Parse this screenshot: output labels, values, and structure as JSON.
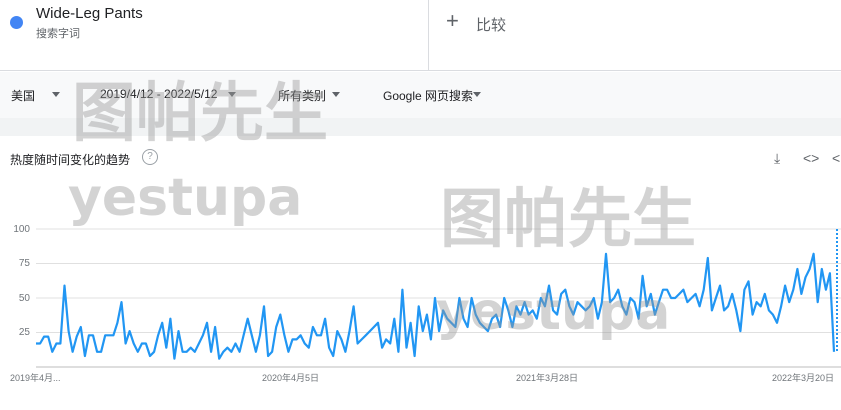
{
  "term": {
    "name": "Wide-Leg Pants",
    "type": "搜索字词"
  },
  "compare": {
    "plus": "+",
    "label": "比较"
  },
  "filters": {
    "region": "美国",
    "date_range": "2019/4/12 - 2022/5/12",
    "category": "所有类别",
    "search_type": "Google 网页搜索"
  },
  "section": {
    "title": "热度随时间变化的趋势",
    "help": "?"
  },
  "tools": {
    "download": "⤓",
    "embed": "<>",
    "share": "<"
  },
  "watermark": {
    "chinese": "图帕先生",
    "latin": "yestupa"
  },
  "colors": {
    "line": "#2196f3",
    "accent": "#4285f4"
  },
  "chart_data": {
    "type": "line",
    "x_tick_labels": [
      "2019年4月...",
      "2020年4月5日",
      "2021年3月28日",
      "2022年3月20日"
    ],
    "y_tick_labels": [
      "100",
      "75",
      "50",
      "25"
    ],
    "ylim": [
      0,
      100
    ],
    "grid": true,
    "series": [
      {
        "values": [
          17,
          17,
          22,
          22,
          11,
          17,
          17,
          59,
          26,
          11,
          22,
          29,
          8,
          23,
          23,
          11,
          11,
          23,
          23,
          23,
          32,
          47,
          17,
          26,
          17,
          11,
          17,
          17,
          8,
          11,
          23,
          32,
          14,
          35,
          6,
          26,
          11,
          11,
          14,
          11,
          17,
          23,
          32,
          11,
          29,
          6,
          11,
          14,
          11,
          17,
          11,
          23,
          35,
          23,
          11,
          23,
          44,
          8,
          11,
          29,
          38,
          23,
          11,
          20,
          20,
          23,
          17,
          14,
          29,
          23,
          23,
          35,
          14,
          8,
          26,
          20,
          11,
          26,
          44,
          17,
          20,
          23,
          26,
          29,
          32,
          14,
          20,
          17,
          35,
          11,
          56,
          14,
          32,
          8,
          44,
          26,
          38,
          20,
          50,
          26,
          41,
          35,
          32,
          29,
          50,
          35,
          29,
          50,
          38,
          32,
          29,
          26,
          35,
          38,
          29,
          50,
          41,
          29,
          44,
          38,
          47,
          38,
          41,
          35,
          50,
          44,
          59,
          41,
          38,
          53,
          56,
          44,
          38,
          47,
          44,
          41,
          44,
          50,
          35,
          47,
          82,
          47,
          50,
          56,
          44,
          38,
          50,
          47,
          35,
          66,
          44,
          53,
          38,
          47,
          56,
          56,
          50,
          50,
          53,
          56,
          47,
          50,
          53,
          44,
          56,
          79,
          41,
          50,
          59,
          41,
          44,
          53,
          41,
          26,
          56,
          62,
          38,
          47,
          44,
          53,
          41,
          38,
          32,
          44,
          59,
          47,
          56,
          71,
          53,
          65,
          71,
          82,
          47,
          71,
          56,
          68,
          11
        ]
      }
    ]
  }
}
